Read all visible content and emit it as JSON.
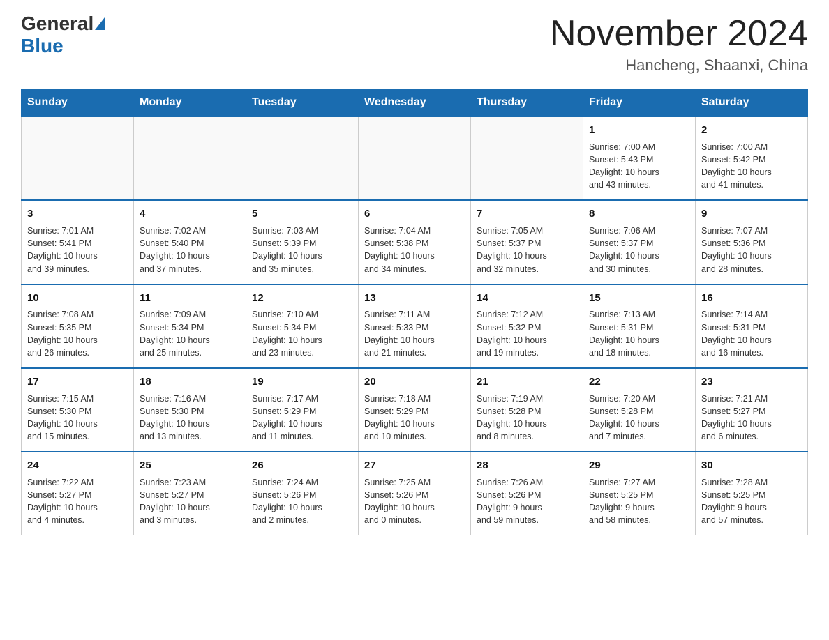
{
  "logo": {
    "general": "General",
    "blue": "Blue",
    "triangle_color": "#1a6cb0"
  },
  "title": "November 2024",
  "subtitle": "Hancheng, Shaanxi, China",
  "days_of_week": [
    "Sunday",
    "Monday",
    "Tuesday",
    "Wednesday",
    "Thursday",
    "Friday",
    "Saturday"
  ],
  "weeks": [
    {
      "days": [
        {
          "num": "",
          "info": ""
        },
        {
          "num": "",
          "info": ""
        },
        {
          "num": "",
          "info": ""
        },
        {
          "num": "",
          "info": ""
        },
        {
          "num": "",
          "info": ""
        },
        {
          "num": "1",
          "info": "Sunrise: 7:00 AM\nSunset: 5:43 PM\nDaylight: 10 hours\nand 43 minutes."
        },
        {
          "num": "2",
          "info": "Sunrise: 7:00 AM\nSunset: 5:42 PM\nDaylight: 10 hours\nand 41 minutes."
        }
      ]
    },
    {
      "days": [
        {
          "num": "3",
          "info": "Sunrise: 7:01 AM\nSunset: 5:41 PM\nDaylight: 10 hours\nand 39 minutes."
        },
        {
          "num": "4",
          "info": "Sunrise: 7:02 AM\nSunset: 5:40 PM\nDaylight: 10 hours\nand 37 minutes."
        },
        {
          "num": "5",
          "info": "Sunrise: 7:03 AM\nSunset: 5:39 PM\nDaylight: 10 hours\nand 35 minutes."
        },
        {
          "num": "6",
          "info": "Sunrise: 7:04 AM\nSunset: 5:38 PM\nDaylight: 10 hours\nand 34 minutes."
        },
        {
          "num": "7",
          "info": "Sunrise: 7:05 AM\nSunset: 5:37 PM\nDaylight: 10 hours\nand 32 minutes."
        },
        {
          "num": "8",
          "info": "Sunrise: 7:06 AM\nSunset: 5:37 PM\nDaylight: 10 hours\nand 30 minutes."
        },
        {
          "num": "9",
          "info": "Sunrise: 7:07 AM\nSunset: 5:36 PM\nDaylight: 10 hours\nand 28 minutes."
        }
      ]
    },
    {
      "days": [
        {
          "num": "10",
          "info": "Sunrise: 7:08 AM\nSunset: 5:35 PM\nDaylight: 10 hours\nand 26 minutes."
        },
        {
          "num": "11",
          "info": "Sunrise: 7:09 AM\nSunset: 5:34 PM\nDaylight: 10 hours\nand 25 minutes."
        },
        {
          "num": "12",
          "info": "Sunrise: 7:10 AM\nSunset: 5:34 PM\nDaylight: 10 hours\nand 23 minutes."
        },
        {
          "num": "13",
          "info": "Sunrise: 7:11 AM\nSunset: 5:33 PM\nDaylight: 10 hours\nand 21 minutes."
        },
        {
          "num": "14",
          "info": "Sunrise: 7:12 AM\nSunset: 5:32 PM\nDaylight: 10 hours\nand 19 minutes."
        },
        {
          "num": "15",
          "info": "Sunrise: 7:13 AM\nSunset: 5:31 PM\nDaylight: 10 hours\nand 18 minutes."
        },
        {
          "num": "16",
          "info": "Sunrise: 7:14 AM\nSunset: 5:31 PM\nDaylight: 10 hours\nand 16 minutes."
        }
      ]
    },
    {
      "days": [
        {
          "num": "17",
          "info": "Sunrise: 7:15 AM\nSunset: 5:30 PM\nDaylight: 10 hours\nand 15 minutes."
        },
        {
          "num": "18",
          "info": "Sunrise: 7:16 AM\nSunset: 5:30 PM\nDaylight: 10 hours\nand 13 minutes."
        },
        {
          "num": "19",
          "info": "Sunrise: 7:17 AM\nSunset: 5:29 PM\nDaylight: 10 hours\nand 11 minutes."
        },
        {
          "num": "20",
          "info": "Sunrise: 7:18 AM\nSunset: 5:29 PM\nDaylight: 10 hours\nand 10 minutes."
        },
        {
          "num": "21",
          "info": "Sunrise: 7:19 AM\nSunset: 5:28 PM\nDaylight: 10 hours\nand 8 minutes."
        },
        {
          "num": "22",
          "info": "Sunrise: 7:20 AM\nSunset: 5:28 PM\nDaylight: 10 hours\nand 7 minutes."
        },
        {
          "num": "23",
          "info": "Sunrise: 7:21 AM\nSunset: 5:27 PM\nDaylight: 10 hours\nand 6 minutes."
        }
      ]
    },
    {
      "days": [
        {
          "num": "24",
          "info": "Sunrise: 7:22 AM\nSunset: 5:27 PM\nDaylight: 10 hours\nand 4 minutes."
        },
        {
          "num": "25",
          "info": "Sunrise: 7:23 AM\nSunset: 5:27 PM\nDaylight: 10 hours\nand 3 minutes."
        },
        {
          "num": "26",
          "info": "Sunrise: 7:24 AM\nSunset: 5:26 PM\nDaylight: 10 hours\nand 2 minutes."
        },
        {
          "num": "27",
          "info": "Sunrise: 7:25 AM\nSunset: 5:26 PM\nDaylight: 10 hours\nand 0 minutes."
        },
        {
          "num": "28",
          "info": "Sunrise: 7:26 AM\nSunset: 5:26 PM\nDaylight: 9 hours\nand 59 minutes."
        },
        {
          "num": "29",
          "info": "Sunrise: 7:27 AM\nSunset: 5:25 PM\nDaylight: 9 hours\nand 58 minutes."
        },
        {
          "num": "30",
          "info": "Sunrise: 7:28 AM\nSunset: 5:25 PM\nDaylight: 9 hours\nand 57 minutes."
        }
      ]
    }
  ]
}
